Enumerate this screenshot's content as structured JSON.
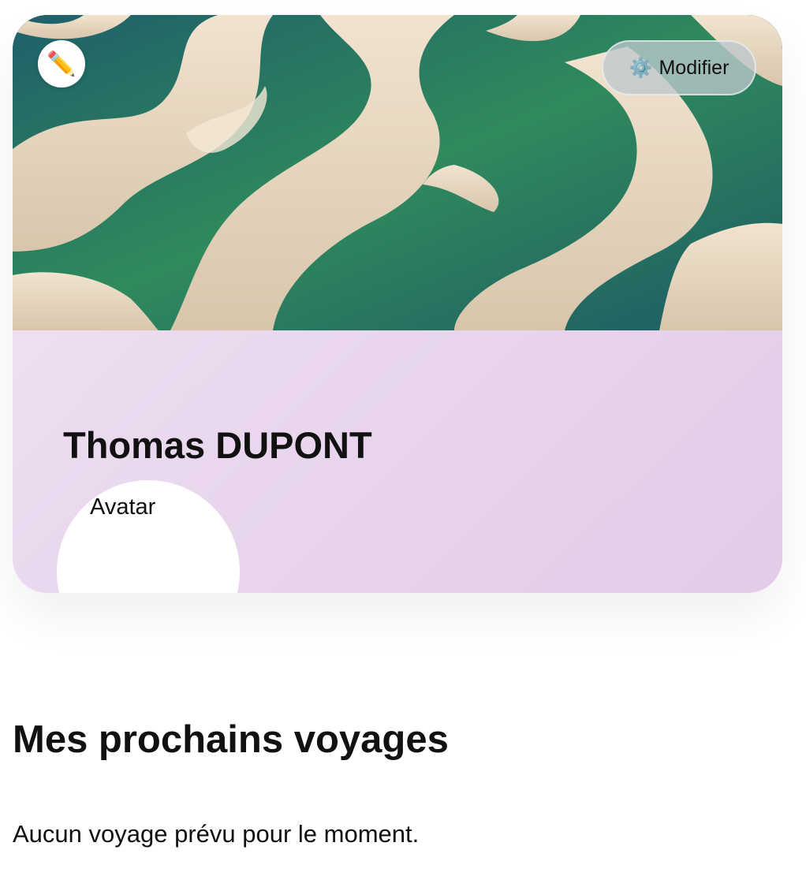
{
  "cover": {
    "edit_icon": "pencil-icon",
    "edit_glyph": "✏️"
  },
  "modify_button": {
    "icon": "gear-icon",
    "icon_glyph": "⚙️",
    "label": "Modifier"
  },
  "profile": {
    "name": "Thomas DUPONT",
    "avatar_alt": "Avatar"
  },
  "trips": {
    "title": "Mes prochains voyages",
    "empty_message": "Aucun voyage prévu pour le moment."
  },
  "colors": {
    "card_gradient_start": "#f3e6f3",
    "card_gradient_end": "#e2cbe8",
    "text": "#111111"
  }
}
